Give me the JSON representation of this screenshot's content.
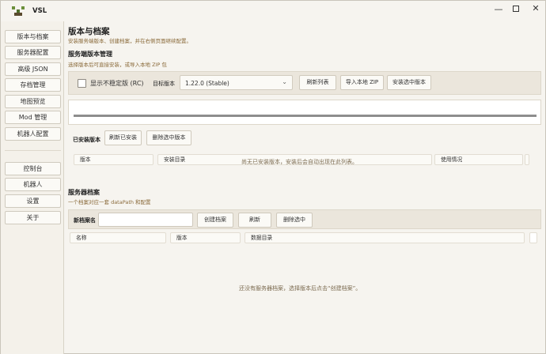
{
  "app": {
    "title": "VSL"
  },
  "window_controls": {
    "minimize": "—",
    "close": "✕"
  },
  "sidebar": {
    "items": [
      {
        "label": "版本与档案"
      },
      {
        "label": "服务器配置"
      },
      {
        "label": "高级 JSON"
      },
      {
        "label": "存档管理"
      },
      {
        "label": "地图预览"
      },
      {
        "label": "Mod 管理"
      },
      {
        "label": "机器人配置"
      },
      {
        "label": "控制台"
      },
      {
        "label": "机器人"
      },
      {
        "label": "设置"
      },
      {
        "label": "关于"
      }
    ]
  },
  "page": {
    "title": "版本与档案",
    "subtitle": "安装服务端版本、创建档案，并在右侧页面继续配置。"
  },
  "server_versions": {
    "title": "服务端版本管理",
    "subtitle": "选择版本后可直接安装，或导入本地 ZIP 包",
    "unstable_checkbox": {
      "label": "显示不稳定版 (RC)",
      "checked": false
    },
    "target_label": "目标版本",
    "target_value": "1.22.0 (Stable)",
    "buttons": {
      "refresh": "刷新列表",
      "import_zip": "导入本地 ZIP",
      "install": "安装选中版本"
    },
    "progress": 1.0
  },
  "installed": {
    "label": "已安装版本",
    "refresh_button": "刷新已安装",
    "delete_button": "删除选中版本",
    "columns": [
      "版本",
      "安装目录",
      "使用情况"
    ],
    "empty_message": "尚无已安装版本，安装后会自动出现在此列表。"
  },
  "profiles": {
    "title": "服务器档案",
    "subtitle": "一个档案对应一套 dataPath 和配置",
    "new_label": "新档案名",
    "new_value": "",
    "buttons": {
      "create": "创建档案",
      "refresh": "刷新",
      "delete": "删除选中"
    },
    "columns": [
      "名称",
      "版本",
      "数据目录"
    ],
    "empty_message": "还没有服务器档案，选择版本后点击“创建档案”。"
  },
  "colors": {
    "accent_text": "#8a6a3a",
    "toolbar_bg": "#ebe6dc",
    "progress_fill": "#8e8e8e"
  }
}
